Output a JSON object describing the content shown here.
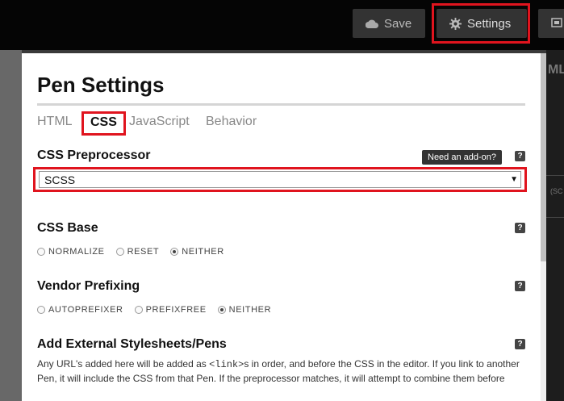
{
  "toolbar": {
    "save_label": "Save",
    "settings_label": "Settings"
  },
  "right_panel": {
    "partial_heading": "ML",
    "partial_text": "(SC"
  },
  "modal": {
    "title": "Pen Settings",
    "tabs": [
      {
        "label": "HTML",
        "active": false
      },
      {
        "label": "CSS",
        "active": true
      },
      {
        "label": "JavaScript",
        "active": false
      },
      {
        "label": "Behavior",
        "active": false
      }
    ],
    "preprocessor": {
      "label": "CSS Preprocessor",
      "addon_tip": "Need an add-on?",
      "value": "SCSS"
    },
    "css_base": {
      "label": "CSS Base",
      "options": [
        "NORMALIZE",
        "RESET",
        "NEITHER"
      ],
      "selected": "NEITHER"
    },
    "vendor": {
      "label": "Vendor Prefixing",
      "options": [
        "AUTOPREFIXER",
        "PREFIXFREE",
        "NEITHER"
      ],
      "selected": "NEITHER"
    },
    "external": {
      "label": "Add External Stylesheets/Pens",
      "desc_part1": "Any URL's added here will be added as ",
      "desc_code": "<link>",
      "desc_part2": "s in order, and before the CSS in the editor. If you link to another Pen, it will include the CSS from that Pen. If the preprocessor matches, it will attempt to combine them before"
    },
    "help_symbol": "?"
  },
  "colors": {
    "highlight": "#e0141e",
    "topbar": "#050505",
    "button_bg": "#333333"
  }
}
